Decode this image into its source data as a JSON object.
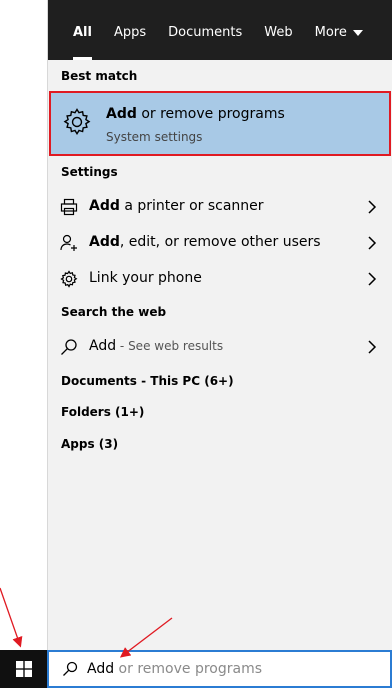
{
  "tabs": [
    {
      "label": "All",
      "active": true
    },
    {
      "label": "Apps"
    },
    {
      "label": "Documents"
    },
    {
      "label": "Web"
    },
    {
      "label": "More"
    }
  ],
  "best_match": {
    "section_title": "Best match",
    "title_bold": "Add",
    "title_rest": " or remove programs",
    "subtitle": "System settings",
    "icon": "gear-icon"
  },
  "settings": {
    "section_title": "Settings",
    "items": [
      {
        "bold": "Add",
        "rest": " a printer or scanner",
        "icon": "printer-icon"
      },
      {
        "bold": "Add",
        "rest": ", edit, or remove other users",
        "icon": "add-user-icon"
      },
      {
        "bold": "",
        "rest": "Link your phone",
        "icon": "gear-icon"
      }
    ]
  },
  "web": {
    "section_title": "Search the web",
    "query": "Add",
    "hint": " - See web results",
    "icon": "search-icon"
  },
  "collapsed": [
    "Documents - This PC (6+)",
    "Folders (1+)",
    "Apps (3)"
  ],
  "search_box": {
    "typed": "Add",
    "suggestion": " or remove programs",
    "icon": "search-icon"
  },
  "colors": {
    "tab_bar": "#1f1f1f",
    "highlight": "#a8c9e6",
    "highlight_border": "#e01a22",
    "search_border": "#2b7cd3",
    "annotation": "#e01a22"
  }
}
